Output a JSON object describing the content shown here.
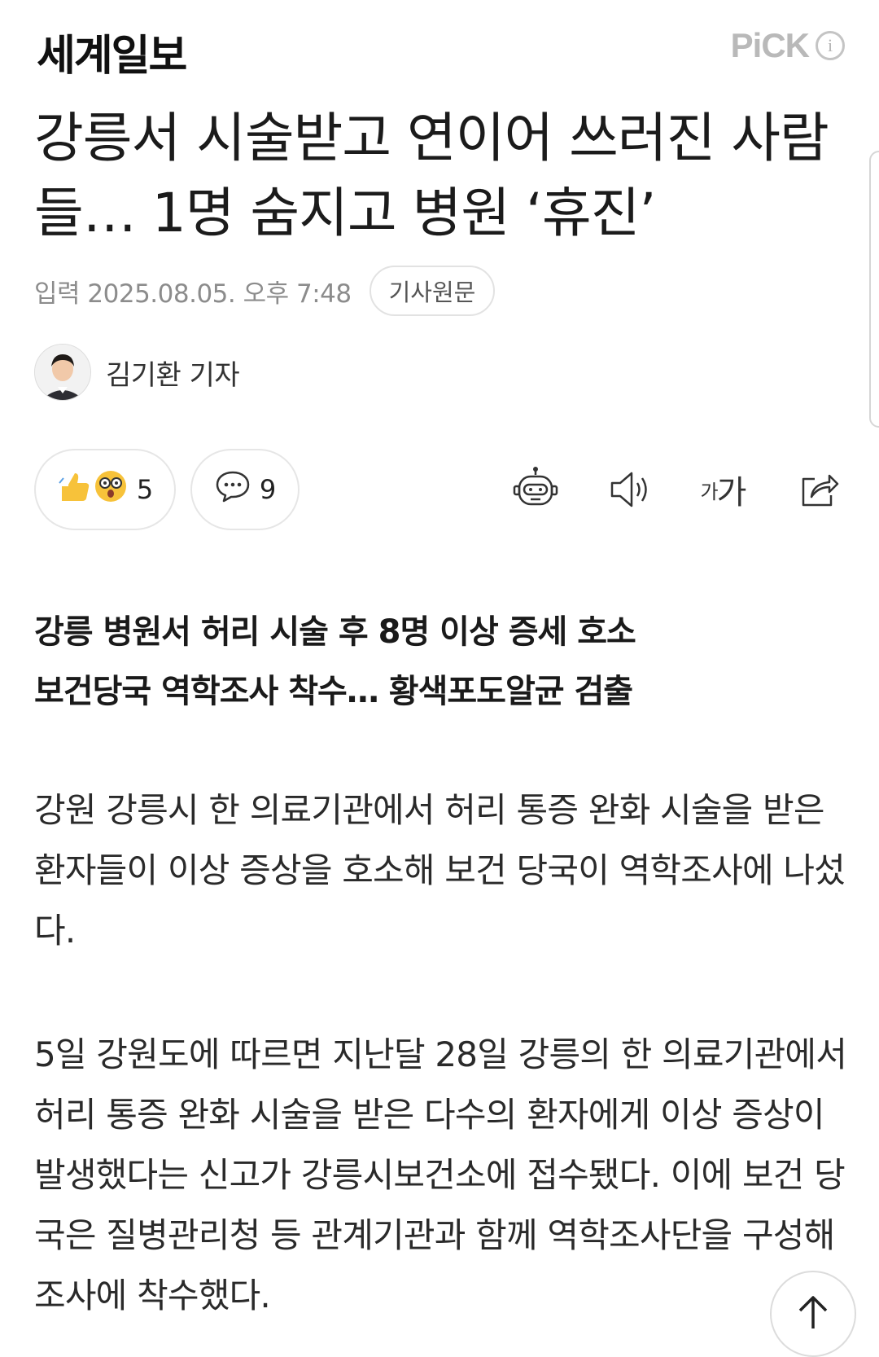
{
  "header": {
    "logo": "세계일보",
    "pick_label": "PiCK",
    "info_icon": "info-icon"
  },
  "article": {
    "headline": "강릉서 시술받고 연이어 쓰러진 사람들… 1명 숨지고 병원 ‘휴진’",
    "date": "입력 2025.08.05. 오후 7:48",
    "original_button": "기사원문",
    "author": "김기환 기자"
  },
  "actions": {
    "reaction_count": "5",
    "comment_count": "9",
    "icons": [
      "bot-summary-icon",
      "speaker-icon",
      "font-size-icon",
      "share-icon"
    ],
    "font_small": "가",
    "font_big": "가"
  },
  "summary": [
    "강릉 병원서 허리 시술 후 8명 이상 증세 호소",
    "보건당국 역학조사 착수… 황색포도알균 검출"
  ],
  "body": [
    "강원 강릉시 한 의료기관에서 허리 통증 완화 시술을 받은 환자들이 이상 증상을 호소해 보건 당국이 역학조사에 나섰다.",
    "5일 강원도에 따르면 지난달 28일 강릉의 한 의료기관에서 허리 통증 완화 시술을 받은 다수의 환자에게 이상 증상이 발생했다는 신고가 강릉시보건소에 접수됐다. 이에 보건 당국은 질병관리청 등 관계기관과 함께 역학조사단을 구성해 조사에 착수했다."
  ],
  "colors": {
    "text": "#111111",
    "muted": "#8c8c8c",
    "border": "#e2e2e2",
    "emoji_yellow": "#f7c23a"
  }
}
